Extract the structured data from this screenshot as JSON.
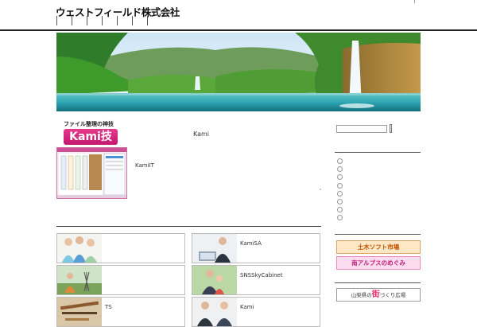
{
  "header": {
    "site_title": "ウェストフィールド株式会社"
  },
  "main": {
    "logo": {
      "tagline": "ファイル整理の神技",
      "name": "Kami技"
    },
    "heading": "Kami",
    "product_label": "KamiIT"
  },
  "cards": [
    {
      "label": "",
      "thumb": "staff-group-photo"
    },
    {
      "label": "KamiSA",
      "thumb": "businessman-laptop-photo"
    },
    {
      "label": "",
      "thumb": "outdoor-survey-photo"
    },
    {
      "label": "SNSSkyCabinet",
      "thumb": "family-photo"
    },
    {
      "label": "TS",
      "thumb": "survey-tools-photo"
    },
    {
      "label": "Kami",
      "thumb": "business-meeting-photo"
    }
  ],
  "sidebar": {
    "search": {
      "value": "",
      "placeholder": ""
    },
    "banners": {
      "doboku": "土木ソフト市場",
      "minami": "南アルプスのめぐみ",
      "yamanashi_pre": "山梨県の",
      "yamanashi_machi": "街",
      "yamanashi_post": "づくり広場"
    }
  },
  "colors": {
    "logo_pink": "#e63a8c",
    "header_rule": "#222222",
    "doboku_text": "#c05000",
    "minami_text": "#c01f7a"
  }
}
